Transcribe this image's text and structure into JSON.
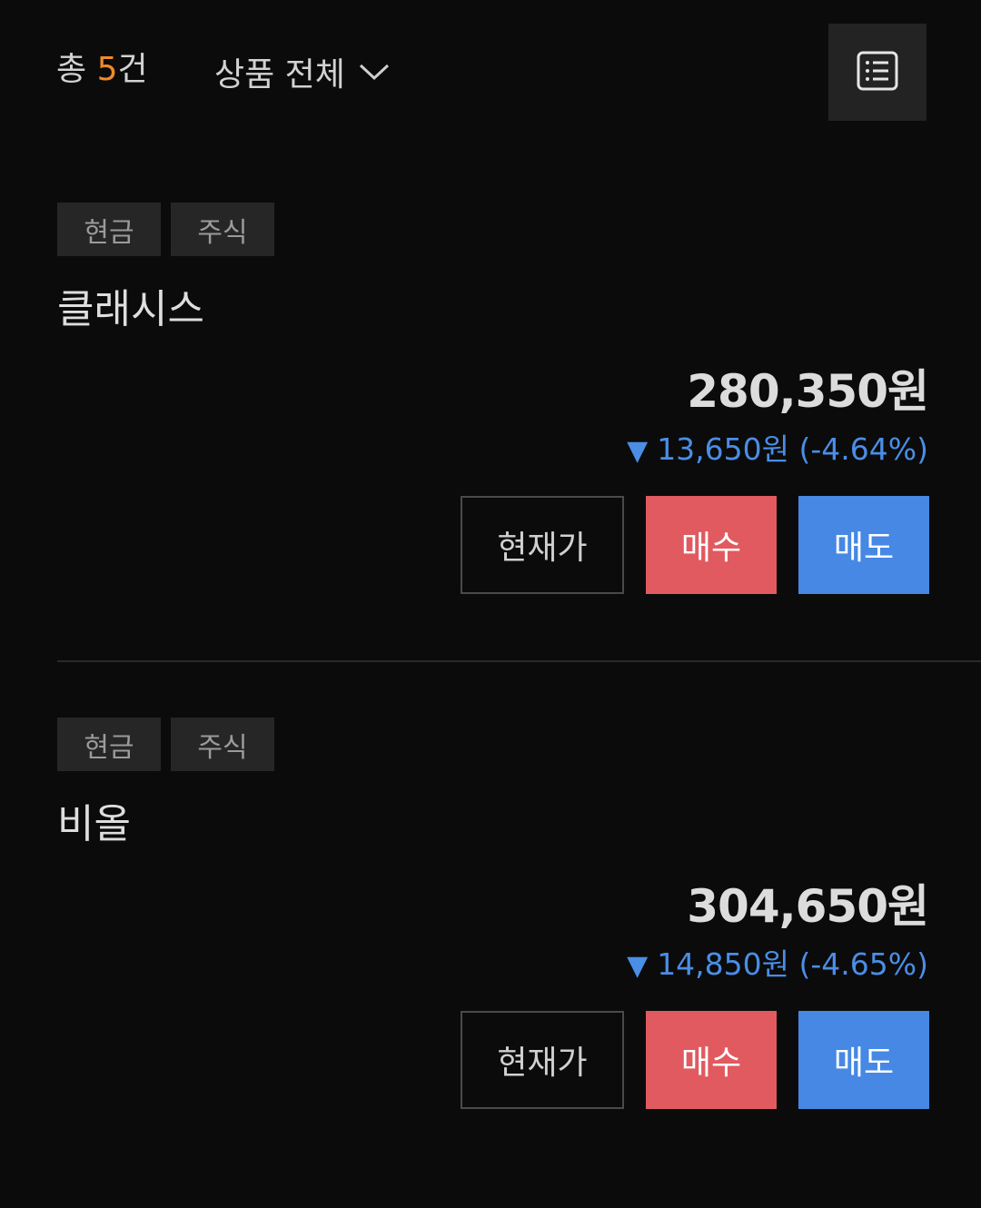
{
  "header": {
    "total_prefix": "총 ",
    "total_count": "5",
    "total_suffix": "건",
    "filter_label": "상품 전체",
    "chevron_icon": "chevron-down-icon",
    "list_icon": "list-view-icon"
  },
  "items": [
    {
      "tags": [
        "현금",
        "주식"
      ],
      "name": "클래시스",
      "price": "280,350원",
      "change_arrow": "▼",
      "change": "13,650원 (-4.64%)",
      "buttons": {
        "current": "현재가",
        "buy": "매수",
        "sell": "매도"
      }
    },
    {
      "tags": [
        "현금",
        "주식"
      ],
      "name": "비올",
      "price": "304,650원",
      "change_arrow": "▼",
      "change": "14,850원 (-4.65%)",
      "buttons": {
        "current": "현재가",
        "buy": "매수",
        "sell": "매도"
      }
    }
  ],
  "colors": {
    "background": "#0b0b0b",
    "count_accent": "#f08a2a",
    "down": "#4a8ee6",
    "buy": "#e05a60",
    "sell": "#4688e4"
  }
}
